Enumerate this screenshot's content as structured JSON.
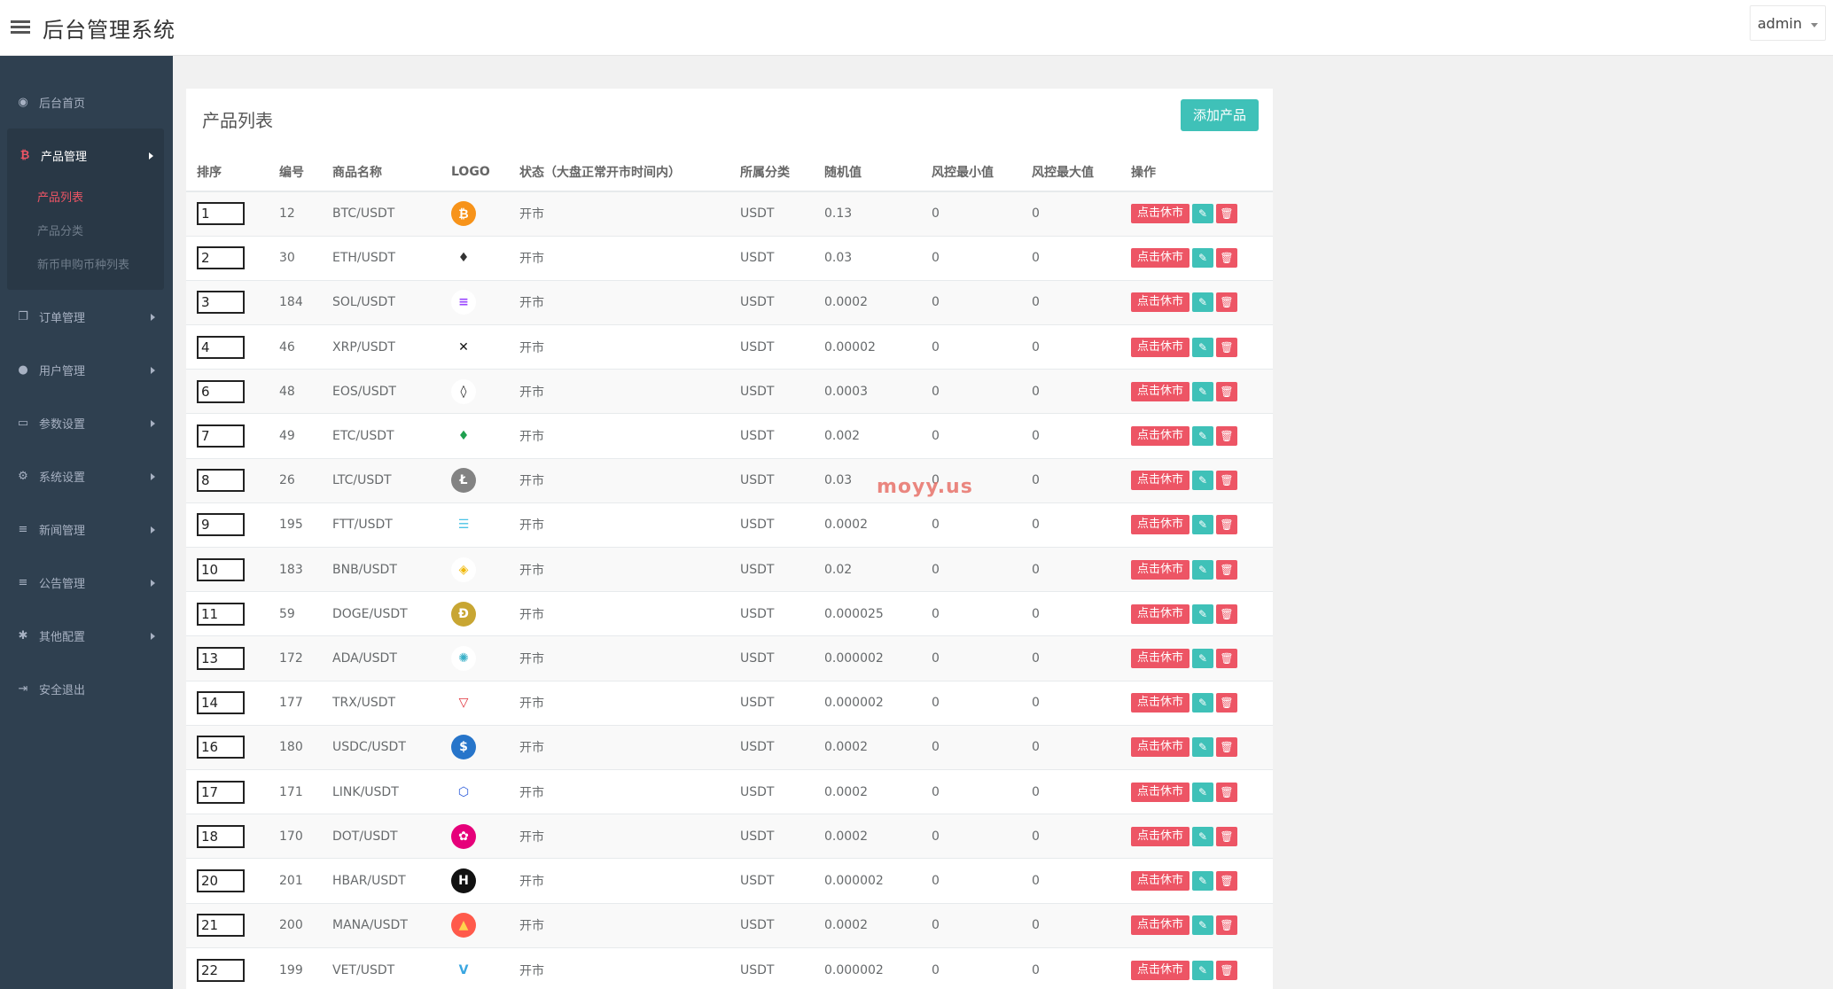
{
  "header": {
    "title": "后台管理系统",
    "user": "admin"
  },
  "sidebar": {
    "items": [
      {
        "label": "后台首页",
        "icon": "dashboard-icon",
        "glyph": "◉"
      },
      {
        "label": "产品管理",
        "icon": "bitcoin-icon",
        "glyph": "₿",
        "sub": [
          {
            "label": "产品列表"
          },
          {
            "label": "产品分类"
          },
          {
            "label": "新币申购币种列表"
          }
        ]
      },
      {
        "label": "订单管理",
        "icon": "copy-icon",
        "glyph": "❐"
      },
      {
        "label": "用户管理",
        "icon": "user-icon",
        "glyph": "●"
      },
      {
        "label": "参数设置",
        "icon": "file-icon",
        "glyph": "▭"
      },
      {
        "label": "系统设置",
        "icon": "gears-icon",
        "glyph": "⚙"
      },
      {
        "label": "新闻管理",
        "icon": "list-icon",
        "glyph": "≡"
      },
      {
        "label": "公告管理",
        "icon": "list-icon",
        "glyph": "≡"
      },
      {
        "label": "其他配置",
        "icon": "gear-icon",
        "glyph": "✱"
      },
      {
        "label": "安全退出",
        "icon": "sign-out-icon",
        "glyph": "⇥"
      }
    ]
  },
  "panel": {
    "title": "产品列表",
    "add_label": "添加产品",
    "columns": [
      "排序",
      "编号",
      "商品名称",
      "LOGO",
      "状态（大盘正常开市时间内）",
      "所属分类",
      "随机值",
      "风控最小值",
      "风控最大值",
      "操作"
    ],
    "halt_label": "点击休市",
    "rows": [
      {
        "sort": "1",
        "id": "12",
        "name": "BTC/USDT",
        "status": "开市",
        "category": "USDT",
        "random": "0.13",
        "min": "0",
        "max": "0",
        "logo": {
          "icon": "btc-icon",
          "glyph": "₿",
          "bg": "#f7931a",
          "fg": "#ffffff"
        }
      },
      {
        "sort": "2",
        "id": "30",
        "name": "ETH/USDT",
        "status": "开市",
        "category": "USDT",
        "random": "0.03",
        "min": "0",
        "max": "0",
        "logo": {
          "icon": "eth-icon",
          "glyph": "♦",
          "bg": "#ffffff",
          "fg": "#333333"
        }
      },
      {
        "sort": "3",
        "id": "184",
        "name": "SOL/USDT",
        "status": "开市",
        "category": "USDT",
        "random": "0.0002",
        "min": "0",
        "max": "0",
        "logo": {
          "icon": "sol-icon",
          "glyph": "≡",
          "bg": "#ffffff",
          "fg": "#9945ff"
        }
      },
      {
        "sort": "4",
        "id": "46",
        "name": "XRP/USDT",
        "status": "开市",
        "category": "USDT",
        "random": "0.00002",
        "min": "0",
        "max": "0",
        "logo": {
          "icon": "xrp-icon",
          "glyph": "✕",
          "bg": "#ffffff",
          "fg": "#111111"
        }
      },
      {
        "sort": "6",
        "id": "48",
        "name": "EOS/USDT",
        "status": "开市",
        "category": "USDT",
        "random": "0.0003",
        "min": "0",
        "max": "0",
        "logo": {
          "icon": "eos-icon",
          "glyph": "◊",
          "bg": "#ffffff",
          "fg": "#222222"
        }
      },
      {
        "sort": "7",
        "id": "49",
        "name": "ETC/USDT",
        "status": "开市",
        "category": "USDT",
        "random": "0.002",
        "min": "0",
        "max": "0",
        "logo": {
          "icon": "etc-icon",
          "glyph": "♦",
          "bg": "#ffffff",
          "fg": "#1fa04f"
        }
      },
      {
        "sort": "8",
        "id": "26",
        "name": "LTC/USDT",
        "status": "开市",
        "category": "USDT",
        "random": "0.03",
        "min": "0",
        "max": "0",
        "logo": {
          "icon": "ltc-icon",
          "glyph": "Ł",
          "bg": "#838383",
          "fg": "#ffffff"
        }
      },
      {
        "sort": "9",
        "id": "195",
        "name": "FTT/USDT",
        "status": "开市",
        "category": "USDT",
        "random": "0.0002",
        "min": "0",
        "max": "0",
        "logo": {
          "icon": "ftt-icon",
          "glyph": "☰",
          "bg": "#ffffff",
          "fg": "#4bc3e6"
        }
      },
      {
        "sort": "10",
        "id": "183",
        "name": "BNB/USDT",
        "status": "开市",
        "category": "USDT",
        "random": "0.02",
        "min": "0",
        "max": "0",
        "logo": {
          "icon": "bnb-icon",
          "glyph": "◈",
          "bg": "#ffffff",
          "fg": "#f0b90b"
        }
      },
      {
        "sort": "11",
        "id": "59",
        "name": "DOGE/USDT",
        "status": "开市",
        "category": "USDT",
        "random": "0.000025",
        "min": "0",
        "max": "0",
        "logo": {
          "icon": "doge-icon",
          "glyph": "Ð",
          "bg": "#c8a633",
          "fg": "#ffffff"
        }
      },
      {
        "sort": "13",
        "id": "172",
        "name": "ADA/USDT",
        "status": "开市",
        "category": "USDT",
        "random": "0.000002",
        "min": "0",
        "max": "0",
        "logo": {
          "icon": "ada-icon",
          "glyph": "✺",
          "bg": "#ffffff",
          "fg": "#3ab0c8"
        }
      },
      {
        "sort": "14",
        "id": "177",
        "name": "TRX/USDT",
        "status": "开市",
        "category": "USDT",
        "random": "0.000002",
        "min": "0",
        "max": "0",
        "logo": {
          "icon": "trx-icon",
          "glyph": "▽",
          "bg": "#ffffff",
          "fg": "#e0313a"
        }
      },
      {
        "sort": "16",
        "id": "180",
        "name": "USDC/USDT",
        "status": "开市",
        "category": "USDT",
        "random": "0.0002",
        "min": "0",
        "max": "0",
        "logo": {
          "icon": "usdc-icon",
          "glyph": "$",
          "bg": "#2775ca",
          "fg": "#ffffff"
        }
      },
      {
        "sort": "17",
        "id": "171",
        "name": "LINK/USDT",
        "status": "开市",
        "category": "USDT",
        "random": "0.0002",
        "min": "0",
        "max": "0",
        "logo": {
          "icon": "link-icon",
          "glyph": "⬡",
          "bg": "#ffffff",
          "fg": "#2a5ada"
        }
      },
      {
        "sort": "18",
        "id": "170",
        "name": "DOT/USDT",
        "status": "开市",
        "category": "USDT",
        "random": "0.0002",
        "min": "0",
        "max": "0",
        "logo": {
          "icon": "dot-icon",
          "glyph": "✿",
          "bg": "#e6007a",
          "fg": "#ffffff"
        }
      },
      {
        "sort": "20",
        "id": "201",
        "name": "HBAR/USDT",
        "status": "开市",
        "category": "USDT",
        "random": "0.000002",
        "min": "0",
        "max": "0",
        "logo": {
          "icon": "hbar-icon",
          "glyph": "H",
          "bg": "#111111",
          "fg": "#ffffff"
        }
      },
      {
        "sort": "21",
        "id": "200",
        "name": "MANA/USDT",
        "status": "开市",
        "category": "USDT",
        "random": "0.0002",
        "min": "0",
        "max": "0",
        "logo": {
          "icon": "mana-icon",
          "glyph": "▲",
          "bg": "#ff5a4b",
          "fg": "#ffd34d"
        }
      },
      {
        "sort": "22",
        "id": "199",
        "name": "VET/USDT",
        "status": "开市",
        "category": "USDT",
        "random": "0.000002",
        "min": "0",
        "max": "0",
        "logo": {
          "icon": "vet-icon",
          "glyph": "V",
          "bg": "#ffffff",
          "fg": "#3aa6e0"
        }
      }
    ]
  },
  "watermark": "moyy.us",
  "colors": {
    "sidebar_bg": "#2f4050",
    "accent_teal": "#3fc1b8",
    "danger": "#ed5565"
  }
}
